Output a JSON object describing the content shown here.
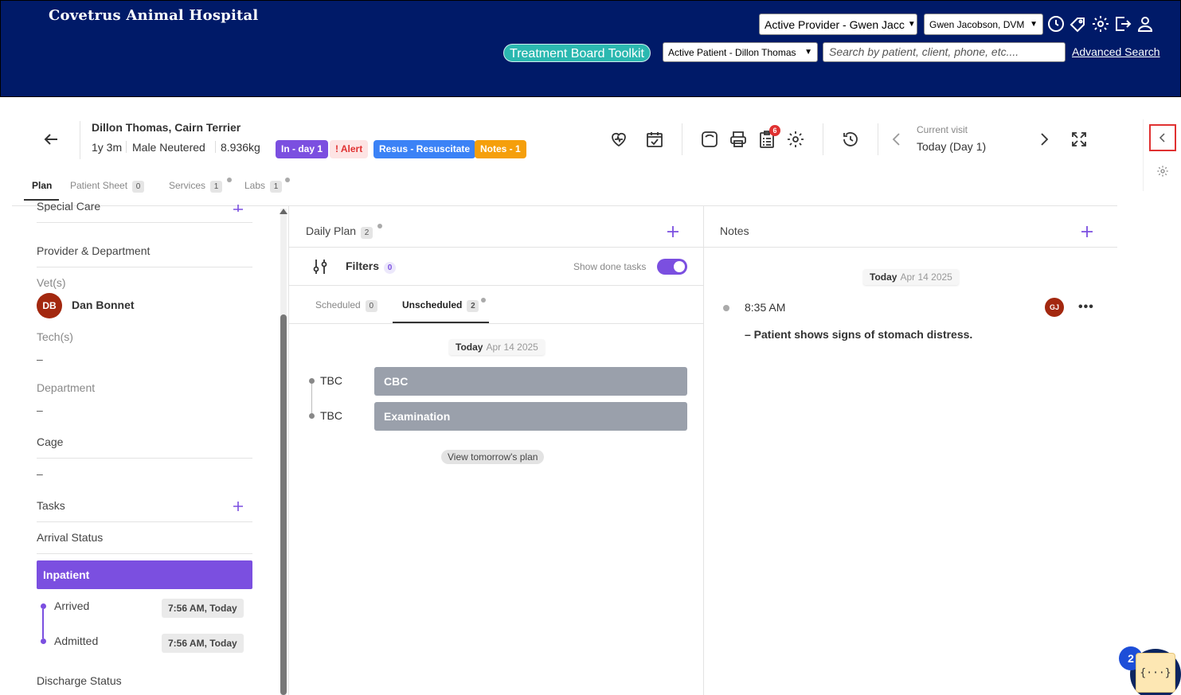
{
  "header": {
    "app_title": "Covetrus Animal Hospital",
    "active_provider": "Active Provider - Gwen Jacc",
    "vet_select": "Gwen Jacobson, DVM",
    "active_patient": "Active Patient - Dillon Thomas",
    "search_placeholder": "Search by patient, client, phone, etc....",
    "advanced_search": "Advanced Search",
    "toolkit_button": "Treatment Board Toolkit",
    "icons": [
      "clock-icon",
      "tag-icon",
      "gear-icon",
      "logout-icon",
      "user-icon"
    ]
  },
  "patient": {
    "name": "Dillon Thomas, Cairn Terrier",
    "age": "1y 3m",
    "sex": "Male Neutered",
    "weight": "8.936kg",
    "badges": {
      "in_day": "In - day 1",
      "alert": "! Alert",
      "resus": "Resus - Resuscitate",
      "notes": "Notes - 1"
    },
    "notification_count": "6",
    "current_visit_label": "Current visit",
    "current_visit_value": "Today (Day 1)"
  },
  "tabs": [
    {
      "label": "Plan",
      "count": ""
    },
    {
      "label": "Patient Sheet",
      "count": "0"
    },
    {
      "label": "Services",
      "count": "1"
    },
    {
      "label": "Labs",
      "count": "1"
    }
  ],
  "sidebar": {
    "special_care": "Special Care",
    "provider_department": "Provider & Department",
    "vets_label": "Vet(s)",
    "vet_initials": "DB",
    "vet_name": "Dan Bonnet",
    "techs_label": "Tech(s)",
    "techs_value": "–",
    "department_label": "Department",
    "department_value": "–",
    "cage_label": "Cage",
    "cage_value": "–",
    "tasks_label": "Tasks",
    "arrival_status_label": "Arrival Status",
    "arrival_status_value": "Inpatient",
    "timeline": [
      {
        "label": "Arrived",
        "time": "7:56 AM, Today"
      },
      {
        "label": "Admitted",
        "time": "7:56 AM, Today"
      }
    ],
    "discharge_status_label": "Discharge Status"
  },
  "daily_plan": {
    "title": "Daily Plan",
    "count": "2",
    "filters_label": "Filters",
    "filters_count": "0",
    "show_done": "Show done tasks",
    "tab_scheduled": "Scheduled",
    "tab_scheduled_count": "0",
    "tab_unscheduled": "Unscheduled",
    "tab_unscheduled_count": "2",
    "date_today": "Today",
    "date": "Apr 14 2025",
    "tasks": [
      {
        "time": "TBC",
        "name": "CBC"
      },
      {
        "time": "TBC",
        "name": "Examination"
      }
    ],
    "view_tomorrow": "View tomorrow's plan"
  },
  "notes": {
    "title": "Notes",
    "date_today": "Today",
    "date": "Apr 14 2025",
    "entry_time": "8:35 AM",
    "entry_text": "– Patient shows signs of stomach distress.",
    "author_initials": "GJ"
  },
  "floating": {
    "help_count": "2",
    "json_button": "{···}"
  }
}
